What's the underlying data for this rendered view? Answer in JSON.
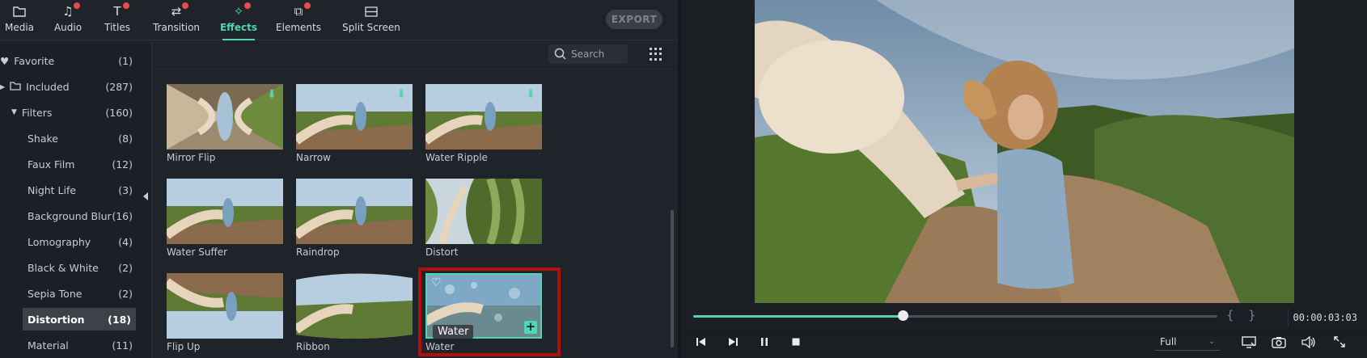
{
  "top_nav": {
    "tabs": [
      {
        "label": "Media",
        "icon": "folder-icon",
        "dot": false
      },
      {
        "label": "Audio",
        "icon": "music-icon",
        "dot": true
      },
      {
        "label": "Titles",
        "icon": "text-icon",
        "dot": true
      },
      {
        "label": "Transition",
        "icon": "transition-icon",
        "dot": true
      },
      {
        "label": "Effects",
        "icon": "effects-icon",
        "dot": true,
        "active": true
      },
      {
        "label": "Elements",
        "icon": "elements-icon",
        "dot": true
      },
      {
        "label": "Split Screen",
        "icon": "split-screen-icon",
        "dot": false
      }
    ],
    "export_label": "EXPORT"
  },
  "sidebar": {
    "items": [
      {
        "label": "Favorite",
        "count": "(1)",
        "icon": "heart-icon"
      },
      {
        "label": "Included",
        "count": "(287)",
        "icon": "folder-icon"
      },
      {
        "label": "Filters",
        "count": "(160)",
        "icon": "caret-down-icon"
      },
      {
        "label": "Shake",
        "count": "(8)"
      },
      {
        "label": "Faux Film",
        "count": "(12)"
      },
      {
        "label": "Night Life",
        "count": "(3)"
      },
      {
        "label": "Background Blur",
        "count": "(16)"
      },
      {
        "label": "Lomography",
        "count": "(4)"
      },
      {
        "label": "Black & White",
        "count": "(2)"
      },
      {
        "label": "Sepia Tone",
        "count": "(2)"
      },
      {
        "label": "Distortion",
        "count": "(18)",
        "active": true
      },
      {
        "label": "Material",
        "count": "(11)"
      }
    ]
  },
  "search": {
    "placeholder": "Search"
  },
  "effects": [
    {
      "label": "Mirror Flip",
      "downloadable": true
    },
    {
      "label": "Narrow",
      "downloadable": true
    },
    {
      "label": "Water Ripple",
      "downloadable": true
    },
    {
      "label": "Water Suffer"
    },
    {
      "label": "Raindrop"
    },
    {
      "label": "Distort"
    },
    {
      "label": "Flip Up"
    },
    {
      "label": "Ribbon"
    },
    {
      "label": "Water",
      "selected": true
    }
  ],
  "tooltip": "Water",
  "player": {
    "progress": 0.4,
    "timecode": "00:00:03:03",
    "mark_in": "{",
    "mark_out": "}",
    "quality": "Full",
    "colors": {
      "accent": "#4fd6b4",
      "highlight": "#b30e0e"
    }
  }
}
